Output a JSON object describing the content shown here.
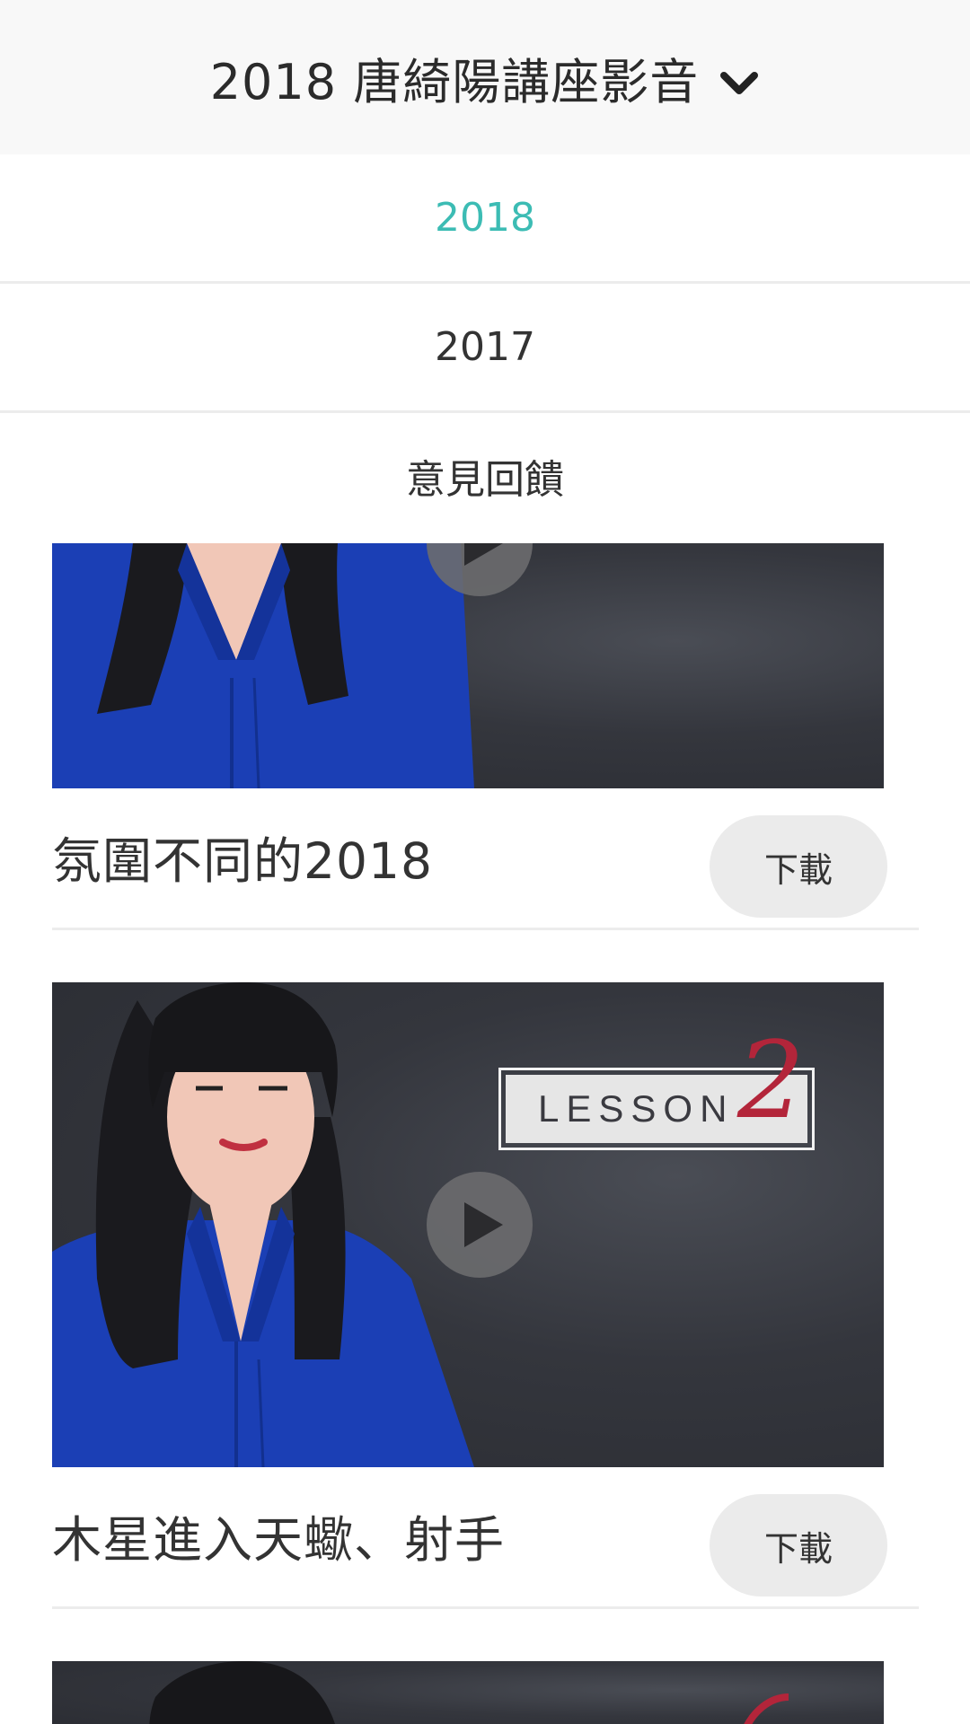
{
  "header": {
    "title": "2018 唐綺陽講座影音",
    "dropdown_icon": "chevron-down-icon"
  },
  "menu": {
    "items": [
      {
        "label": "2018",
        "active": true
      },
      {
        "label": "2017",
        "active": false
      },
      {
        "label": "意見回饋",
        "active": false
      }
    ]
  },
  "videos": [
    {
      "title": "氛圍不同的2018",
      "download_label": "下載",
      "badge": null
    },
    {
      "title": "木星進入天蠍、射手",
      "download_label": "下載",
      "badge": {
        "text": "LESSON",
        "number": "2"
      }
    }
  ],
  "colors": {
    "accent": "#3cbcb4",
    "header_bg": "#f8f8f8",
    "button_bg": "#ebebeb",
    "thumb_bg": "#34363d",
    "shirt": "#1b3fb5"
  }
}
